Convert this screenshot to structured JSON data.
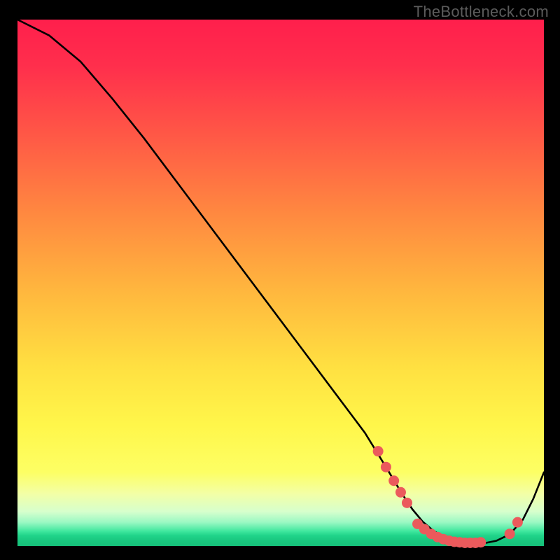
{
  "watermark": "TheBottleneck.com",
  "chart_data": {
    "type": "line",
    "title": "",
    "xlabel": "",
    "ylabel": "",
    "xlim": [
      0,
      100
    ],
    "ylim": [
      0,
      100
    ],
    "grid": false,
    "series": [
      {
        "name": "curve",
        "color": "#000000",
        "x": [
          0,
          6,
          12,
          18,
          24,
          30,
          36,
          42,
          48,
          54,
          60,
          66,
          70,
          73,
          75,
          77,
          79,
          81,
          83,
          85,
          87,
          89,
          91,
          93.5,
          96,
          98,
          100
        ],
        "y": [
          100,
          97,
          92,
          85,
          77.5,
          69.5,
          61.5,
          53.5,
          45.5,
          37.5,
          29.5,
          21.5,
          15,
          10,
          7,
          4.6,
          2.9,
          1.7,
          1.0,
          0.6,
          0.5,
          0.6,
          1.0,
          2.2,
          5.0,
          9.0,
          14.0
        ]
      },
      {
        "name": "dots",
        "color": "#eb5a5c",
        "x": [
          68.5,
          70.0,
          71.5,
          72.8,
          74.0,
          76.0,
          77.3,
          78.6,
          79.8,
          80.9,
          82.0,
          83.0,
          84.0,
          85.0,
          86.0,
          87.0,
          88.0,
          93.5,
          95.0
        ],
        "y": [
          18.0,
          15.0,
          12.4,
          10.2,
          8.2,
          4.2,
          3.2,
          2.3,
          1.7,
          1.3,
          1.0,
          0.8,
          0.7,
          0.6,
          0.6,
          0.6,
          0.7,
          2.3,
          4.5
        ]
      }
    ],
    "background_gradient": {
      "top": "#ff1f4c",
      "mid": "#ffe041",
      "bottom": "#16bf79"
    }
  }
}
